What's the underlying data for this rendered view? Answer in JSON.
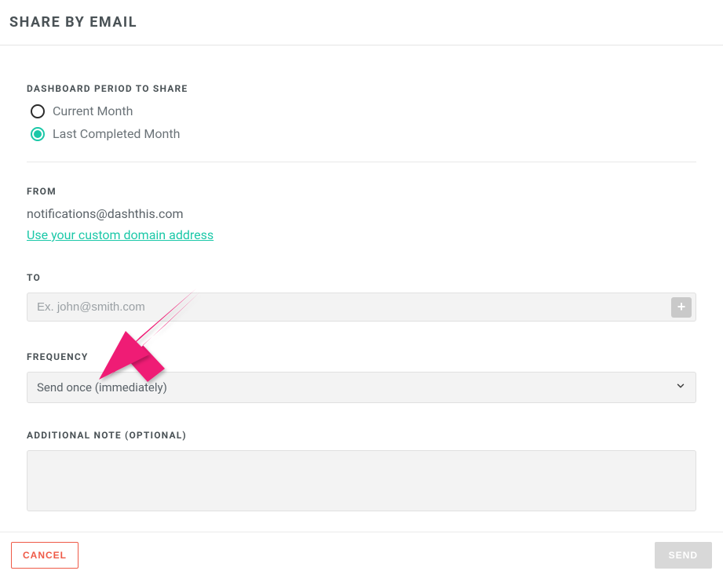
{
  "header": {
    "title": "SHARE BY EMAIL"
  },
  "period": {
    "label": "DASHBOARD PERIOD TO SHARE",
    "options": {
      "current": "Current Month",
      "last": "Last Completed Month"
    }
  },
  "from": {
    "label": "FROM",
    "email": "notifications@dashthis.com",
    "custom_link": "Use your custom domain address"
  },
  "to": {
    "label": "TO",
    "placeholder": "Ex. john@smith.com"
  },
  "frequency": {
    "label": "FREQUENCY",
    "selected": "Send once (immediately)"
  },
  "note": {
    "label": "ADDITIONAL NOTE (OPTIONAL)"
  },
  "footer": {
    "cancel": "CANCEL",
    "send": "SEND"
  },
  "colors": {
    "accent": "#1bc8a8",
    "danger": "#ef5a47",
    "arrow": "#ef1d75"
  }
}
